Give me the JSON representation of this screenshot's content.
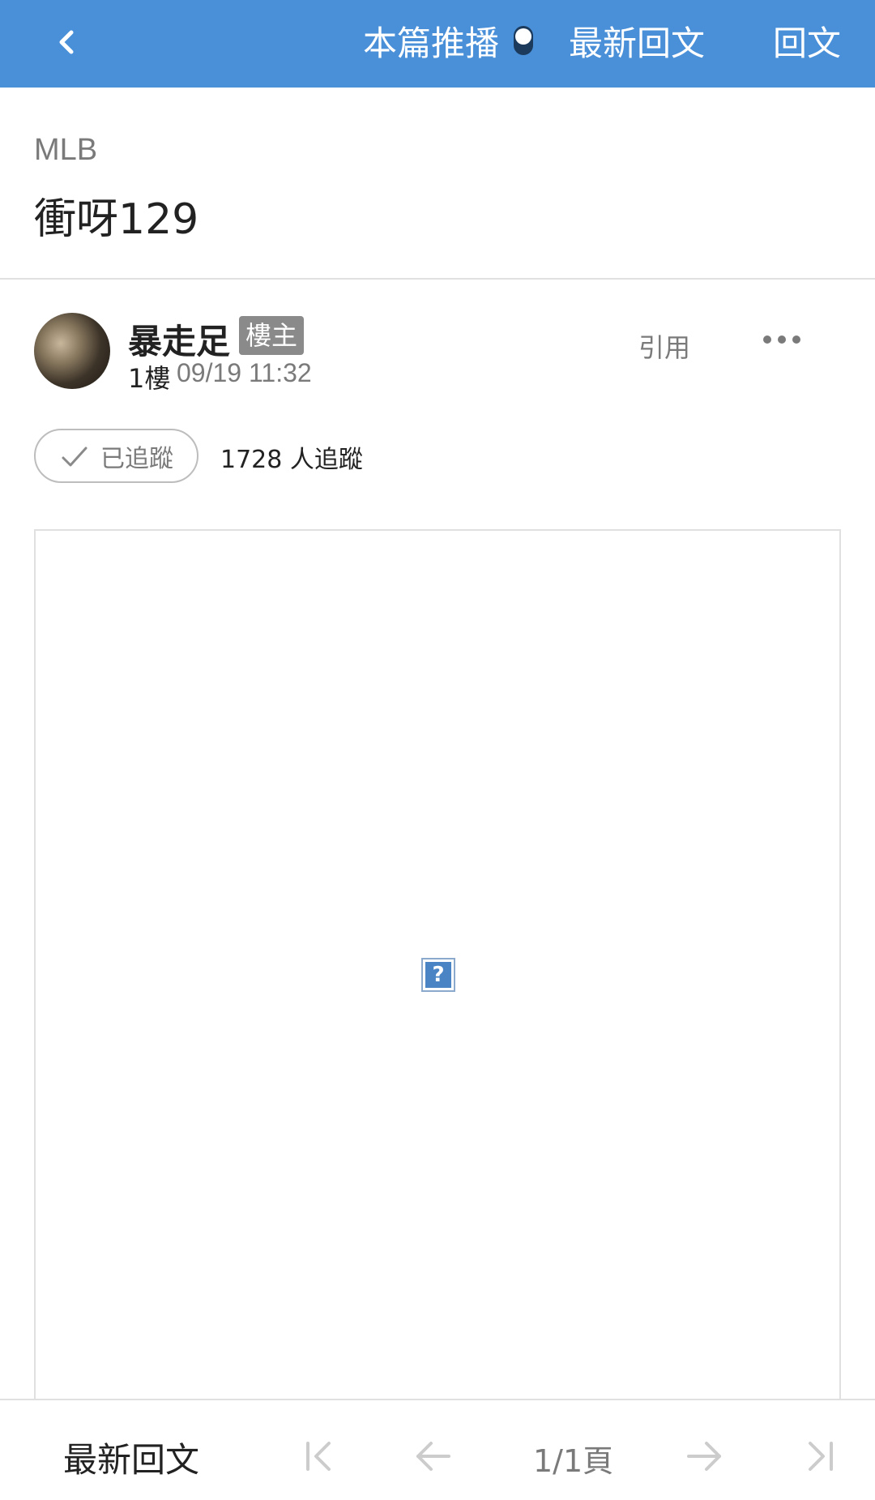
{
  "topbar": {
    "back_icon": "chevron-left-icon",
    "push_label": "本篇推播",
    "push_toggle_on": true,
    "latest_label": "最新回文",
    "reply_label": "回文",
    "background": "#4a90d9"
  },
  "header": {
    "board": "MLB",
    "title": "衝呀129"
  },
  "post": {
    "author": "暴走足",
    "op_badge": "樓主",
    "floor": "1樓",
    "time": "09/19 11:32",
    "quote_label": "引用",
    "more_icon": "ellipsis-icon"
  },
  "follow": {
    "button_label": "已追蹤",
    "count_text": "1728 人追蹤",
    "check_icon": "check-icon"
  },
  "content": {
    "broken_image_glyph": "?"
  },
  "bottombar": {
    "latest_label": "最新回文",
    "page_indicator": "1/1頁",
    "first_icon": "first-page-icon",
    "prev_icon": "arrow-left-icon",
    "next_icon": "arrow-right-icon",
    "last_icon": "last-page-icon"
  }
}
